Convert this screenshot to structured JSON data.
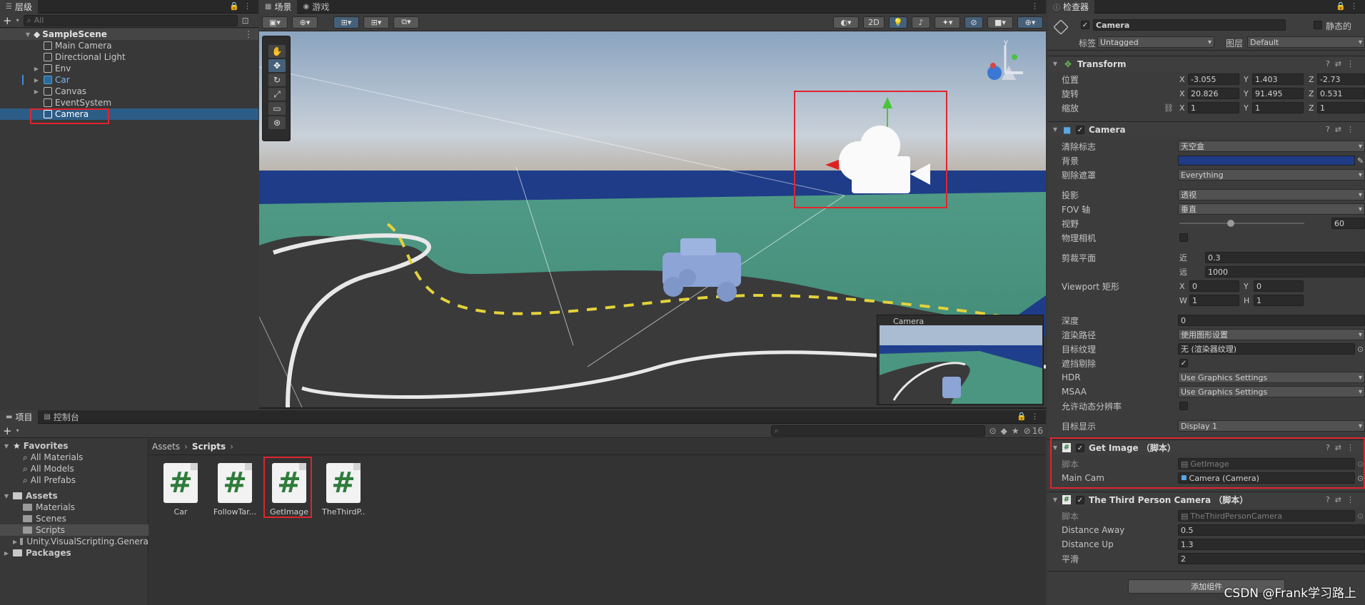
{
  "hierarchy": {
    "tab_label": "层级",
    "search_placeholder": "All",
    "scene_name": "SampleScene",
    "items": [
      {
        "label": "Main Camera"
      },
      {
        "label": "Directional Light"
      },
      {
        "label": "Env"
      },
      {
        "label": "Car"
      },
      {
        "label": "Canvas"
      },
      {
        "label": "EventSystem"
      },
      {
        "label": "Camera"
      }
    ]
  },
  "scene_view": {
    "tab_scene": "场景",
    "tab_game": "游戏",
    "btn_2d": "2D",
    "preview_title": "Camera",
    "axis_y": "y"
  },
  "inspector": {
    "tab_label": "检查器",
    "object_name": "Camera",
    "static_label": "静态的",
    "tag_label": "标签",
    "tag_value": "Untagged",
    "layer_label": "图层",
    "layer_value": "Default",
    "transform": {
      "title": "Transform",
      "position_label": "位置",
      "rotation_label": "旋转",
      "scale_label": "缩放",
      "position": {
        "x": "-3.055",
        "y": "1.403",
        "z": "-2.73"
      },
      "rotation": {
        "x": "20.826",
        "y": "91.495",
        "z": "0.531"
      },
      "scale": {
        "x": "1",
        "y": "1",
        "z": "1"
      }
    },
    "camera": {
      "title": "Camera",
      "clear_flags_label": "清除标志",
      "clear_flags_value": "天空盒",
      "background_label": "背景",
      "background_color": "#1f3a86",
      "culling_mask_label": "剔除遮罩",
      "culling_mask_value": "Everything",
      "projection_label": "投影",
      "projection_value": "透视",
      "fov_axis_label": "FOV 轴",
      "fov_axis_value": "垂直",
      "fov_label": "视野",
      "fov_value": "60",
      "physical_label": "物理相机",
      "clipping_label": "剪裁平面",
      "near_label": "近",
      "near_value": "0.3",
      "far_label": "远",
      "far_value": "1000",
      "viewport_label": "Viewport 矩形",
      "vp_x": "0",
      "vp_y": "0",
      "vp_w": "1",
      "vp_h": "1",
      "depth_label": "深度",
      "depth_value": "0",
      "render_path_label": "渲染路径",
      "render_path_value": "使用图形设置",
      "target_texture_label": "目标纹理",
      "target_texture_value": "无 (渲染器纹理)",
      "occlusion_label": "遮挡剔除",
      "hdr_label": "HDR",
      "hdr_value": "Use Graphics Settings",
      "msaa_label": "MSAA",
      "msaa_value": "Use Graphics Settings",
      "dynamic_res_label": "允许动态分辨率",
      "target_display_label": "目标显示",
      "target_display_value": "Display 1"
    },
    "getimage": {
      "title": "Get Image （脚本）",
      "script_label": "脚本",
      "script_value": "GetImage",
      "main_cam_label": "Main Cam",
      "main_cam_value": "Camera (Camera)"
    },
    "thirdperson": {
      "title": "The Third Person Camera （脚本）",
      "script_label": "脚本",
      "script_value": "TheThirdPersonCamera",
      "distance_away_label": "Distance Away",
      "distance_away_value": "0.5",
      "distance_up_label": "Distance Up",
      "distance_up_value": "1.3",
      "smooth_label": "平滑",
      "smooth_value": "2"
    },
    "add_component": "添加组件"
  },
  "project": {
    "tab_project": "项目",
    "tab_console": "控制台",
    "hidden_count": "16",
    "favorites_label": "Favorites",
    "favorites": [
      "All Materials",
      "All Models",
      "All Prefabs"
    ],
    "assets_label": "Assets",
    "asset_folders": [
      "Materials",
      "Scenes",
      "Scripts",
      "Unity.VisualScripting.Genera"
    ],
    "packages_label": "Packages",
    "breadcrumb_root": "Assets",
    "breadcrumb_current": "Scripts",
    "files": [
      {
        "name": "Car"
      },
      {
        "name": "FollowTar..."
      },
      {
        "name": "GetImage"
      },
      {
        "name": "TheThirdP..."
      }
    ]
  },
  "watermark": "CSDN @Frank学习路上"
}
